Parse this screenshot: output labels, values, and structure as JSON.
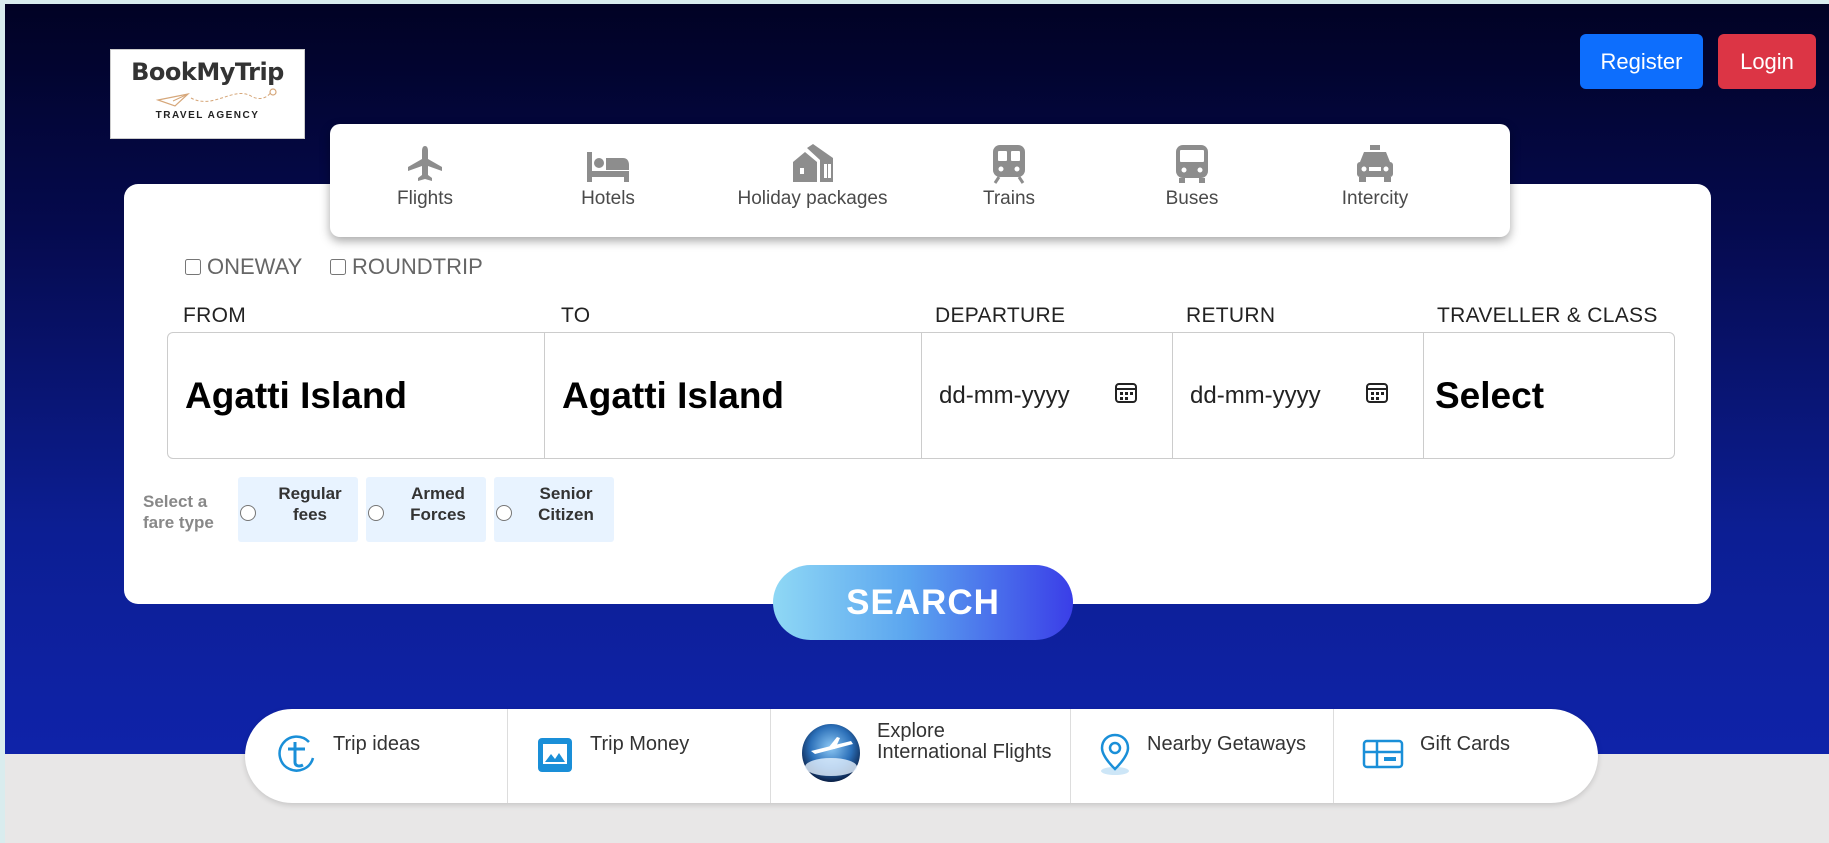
{
  "logo": {
    "brand": "BookMyTrip",
    "tagline": "TRAVEL AGENCY"
  },
  "header": {
    "register_label": "Register",
    "login_label": "Login"
  },
  "tabs": [
    {
      "label": "Flights",
      "icon": "plane-icon"
    },
    {
      "label": "Hotels",
      "icon": "bed-icon"
    },
    {
      "label": "Holiday packages",
      "icon": "houses-icon"
    },
    {
      "label": "Trains",
      "icon": "train-icon"
    },
    {
      "label": "Buses",
      "icon": "bus-icon"
    },
    {
      "label": "Intercity",
      "icon": "taxi-icon"
    }
  ],
  "trip_type": {
    "oneway": "ONEWAY",
    "roundtrip": "ROUNDTRIP"
  },
  "labels": {
    "from": "FROM",
    "to": "TO",
    "departure": "DEPARTURE",
    "return": "RETURN",
    "traveller": "TRAVELLER & CLASS"
  },
  "fields": {
    "from": "Agatti Island",
    "to": "Agatti Island",
    "departure_placeholder": "dd-mm-yyyy",
    "return_placeholder": "dd-mm-yyyy",
    "traveller": "Select"
  },
  "fare": {
    "label": "Select a fare type",
    "options": [
      "Regular fees",
      "Armed Forces",
      "Senior Citizen"
    ]
  },
  "search_label": "SEARCH",
  "bottom": [
    {
      "label": "Trip ideas",
      "icon": "trip-ideas-icon"
    },
    {
      "label": "Trip Money",
      "icon": "trip-money-icon"
    },
    {
      "label": "Explore International Flights",
      "icon": "globe-plane-icon"
    },
    {
      "label": "Nearby Getaways",
      "icon": "location-pin-icon"
    },
    {
      "label": "Gift Cards",
      "icon": "gift-card-icon"
    }
  ],
  "colors": {
    "register": "#0d6efd",
    "login": "#dc3545",
    "fare_bg": "#e8f3ff",
    "accent": "#1a8fd8"
  }
}
